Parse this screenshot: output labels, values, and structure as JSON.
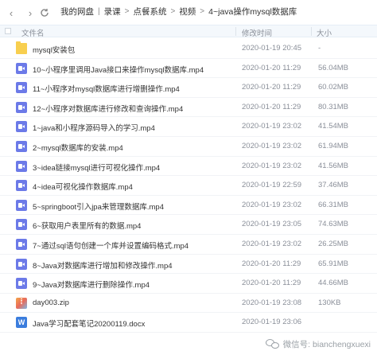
{
  "toolbar": {
    "back_icon": "chevron-left-icon",
    "forward_icon": "chevron-right-icon",
    "refresh_icon": "refresh-icon",
    "breadcrumbs": [
      "我的网盘",
      "录课",
      "点餐系统",
      "视频",
      "4~java操作mysql数据库"
    ]
  },
  "columns": {
    "name": "文件名",
    "date": "修改时间",
    "size": "大小"
  },
  "files": [
    {
      "type": "folder",
      "name": "mysql安装包",
      "date": "2020-01-19 20:45",
      "size": "-"
    },
    {
      "type": "video",
      "name": "10~小程序里调用Java接口来操作mysql数据库.mp4",
      "date": "2020-01-20 11:29",
      "size": "56.04MB"
    },
    {
      "type": "video",
      "name": "11~小程序对mysql数据库进行增删操作.mp4",
      "date": "2020-01-20 11:29",
      "size": "60.02MB"
    },
    {
      "type": "video",
      "name": "12~小程序对数据库进行修改和查询操作.mp4",
      "date": "2020-01-20 11:29",
      "size": "80.31MB"
    },
    {
      "type": "video",
      "name": "1~java和小程序源码导入的学习.mp4",
      "date": "2020-01-19 23:02",
      "size": "41.54MB"
    },
    {
      "type": "video",
      "name": "2~mysql数据库的安装.mp4",
      "date": "2020-01-19 23:02",
      "size": "61.94MB"
    },
    {
      "type": "video",
      "name": "3~idea链接mysql进行可视化操作.mp4",
      "date": "2020-01-19 23:02",
      "size": "41.56MB"
    },
    {
      "type": "video",
      "name": "4~idea可视化操作数据库.mp4",
      "date": "2020-01-19 22:59",
      "size": "37.46MB"
    },
    {
      "type": "video",
      "name": "5~springboot引入jpa来管理数据库.mp4",
      "date": "2020-01-19 23:02",
      "size": "66.31MB"
    },
    {
      "type": "video",
      "name": "6~获取用户表里所有的数据.mp4",
      "date": "2020-01-19 23:05",
      "size": "74.63MB"
    },
    {
      "type": "video",
      "name": "7~通过sql语句创建一个库并设置编码格式.mp4",
      "date": "2020-01-19 23:02",
      "size": "26.25MB"
    },
    {
      "type": "video",
      "name": "8~Java对数据库进行增加和修改操作.mp4",
      "date": "2020-01-20 11:29",
      "size": "65.91MB"
    },
    {
      "type": "video",
      "name": "9~Java对数据库进行删除操作.mp4",
      "date": "2020-01-20 11:29",
      "size": "44.66MB"
    },
    {
      "type": "zip",
      "name": "day003.zip",
      "date": "2020-01-19 23:08",
      "size": "130KB"
    },
    {
      "type": "doc",
      "name": "Java学习配套笔记20200119.docx",
      "date": "2020-01-19 23:06",
      "size": ""
    }
  ],
  "watermark": {
    "text": "微信号: bianchengxuexi",
    "icon": "wechat-icon"
  },
  "colors": {
    "folder": "#f8cf4f",
    "video": "#6c7ae8",
    "doc": "#3b7ddd",
    "header_bg": "#f4f8fc"
  }
}
